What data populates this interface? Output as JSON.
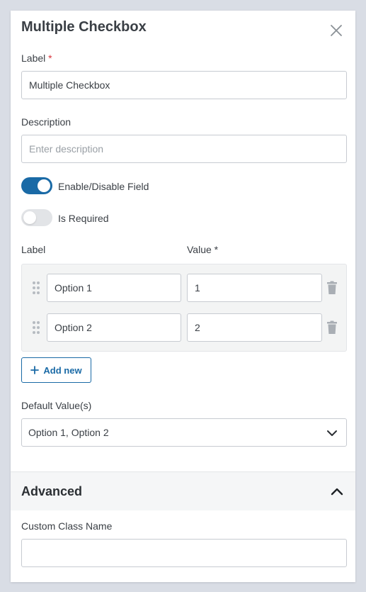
{
  "header": {
    "title": "Multiple Checkbox"
  },
  "label_field": {
    "label": "Label",
    "required_mark": "*",
    "value": "Multiple Checkbox"
  },
  "description_field": {
    "label": "Description",
    "placeholder": "Enter description",
    "value": ""
  },
  "toggles": [
    {
      "label": "Enable/Disable Field",
      "on": true
    },
    {
      "label": "Is Required",
      "on": false
    }
  ],
  "options": {
    "col_label": "Label",
    "col_value": "Value *",
    "rows": [
      {
        "label": "Option 1",
        "value": "1"
      },
      {
        "label": "Option 2",
        "value": "2"
      }
    ],
    "add_label": "Add new"
  },
  "default_value": {
    "label": "Default Value(s)",
    "selected": "Option 1, Option 2"
  },
  "advanced": {
    "title": "Advanced",
    "custom_class": {
      "label": "Custom Class Name",
      "value": ""
    }
  },
  "colors": {
    "accent": "#1a6aa6",
    "required": "#d9363e",
    "toggle_off": "#e2e4e7"
  },
  "icons": [
    "close-icon",
    "drag-handle-icon",
    "trash-icon",
    "plus-icon",
    "chevron-down-icon",
    "chevron-up-icon"
  ]
}
